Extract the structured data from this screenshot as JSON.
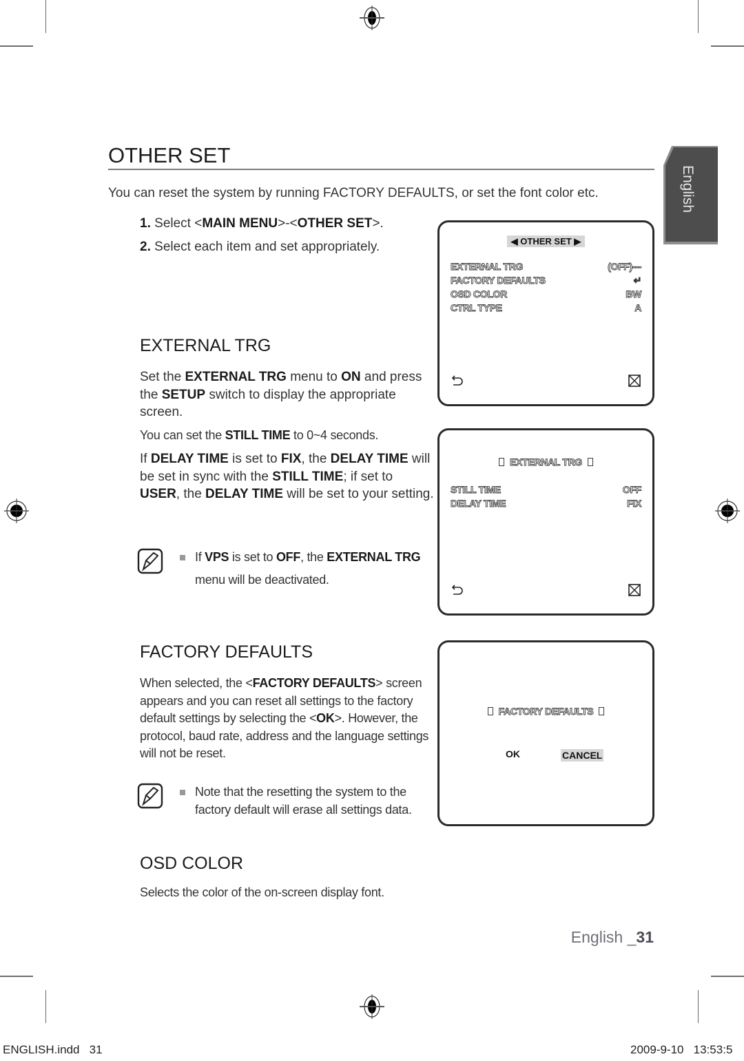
{
  "page": {
    "title": "OTHER SET",
    "intro": "You can reset the system by running FACTORY DEFAULTS, or set the font color etc.",
    "steps": [
      {
        "num": "1.",
        "pre": "Select <",
        "b1": "MAIN MENU",
        "mid": ">-<",
        "b2": "OTHER SET",
        "post": ">."
      },
      {
        "num": "2.",
        "text": "Select each item and set appropriately."
      }
    ],
    "side_tab": "English",
    "footer": {
      "lang": "English _",
      "page": "31"
    },
    "slug": {
      "file": "ENGLISH.indd   31",
      "date": "2009-9-10   13:53:5"
    }
  },
  "external_trg": {
    "heading": "EXTERNAL TRG",
    "p1": {
      "a": "Set the ",
      "b1": "EXTERNAL TRG",
      "c": " menu to ",
      "b2": "ON",
      "d": " and press the ",
      "b3": "SETUP",
      "e": " switch to display the appropriate screen."
    },
    "p2": {
      "a": "You can set the ",
      "b1": "STILL TIME",
      "c": " to 0~4 seconds."
    },
    "p3": {
      "a": "If ",
      "b1": "DELAY TIME",
      "c": " is set to ",
      "b2": "FIX",
      "d": ", the ",
      "b3": "DELAY TIME",
      "e": " will be set in sync with the ",
      "b4": "STILL TIME",
      "f": "; if set to ",
      "b5": "USER",
      "g": ", the ",
      "b6": "DELAY TIME",
      "h": " will be set to your setting."
    },
    "note": {
      "a": "If ",
      "b1": "VPS",
      "c": " is set to ",
      "b2": "OFF",
      "d": ", the ",
      "b3": "EXTERNAL TRG",
      "e": " menu will be deactivated."
    }
  },
  "factory_defaults": {
    "heading": "FACTORY DEFAULTS",
    "p1": {
      "a": "When selected, the <",
      "b1": "FACTORY DEFAULTS",
      "c": "> screen appears and you can reset all settings to the factory default settings by selecting the <",
      "b2": "OK",
      "d": ">. However, the protocol, baud rate, address and the language settings will not be reset."
    },
    "note": "Note that the resetting the system to the factory default will erase all settings data."
  },
  "osd_color": {
    "heading": "OSD COLOR",
    "p1": "Selects the color of the on-screen display font."
  },
  "osd_screens": {
    "other_set": {
      "title": "OTHER SET",
      "rows": [
        {
          "label": "EXTERNAL TRG",
          "value": "(OFF)---"
        },
        {
          "label": "FACTORY DEFAULTS",
          "value": "↵"
        },
        {
          "label": "OSD COLOR",
          "value": "BW"
        },
        {
          "label": "CTRL TYPE",
          "value": "A"
        }
      ]
    },
    "external_trg": {
      "title": "EXTERNAL TRG",
      "rows": [
        {
          "label": "STILL TIME",
          "value": "OFF"
        },
        {
          "label": "DELAY TIME",
          "value": "FIX"
        }
      ]
    },
    "factory_defaults": {
      "title": "FACTORY DEFAULTS",
      "ok": "OK",
      "cancel": "CANCEL"
    }
  }
}
